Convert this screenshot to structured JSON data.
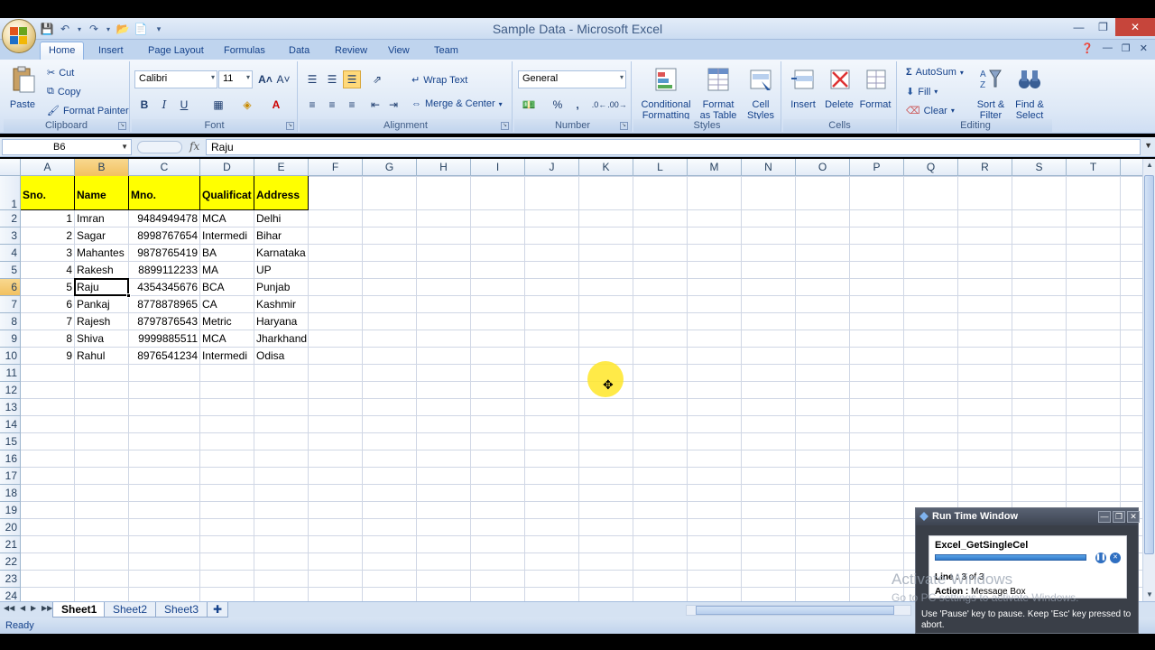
{
  "window": {
    "title": "Sample Data - Microsoft Excel"
  },
  "tabs": [
    "Home",
    "Insert",
    "Page Layout",
    "Formulas",
    "Data",
    "Review",
    "View",
    "Team"
  ],
  "ribbon": {
    "clipboard": {
      "label": "Clipboard",
      "paste": "Paste",
      "cut": "Cut",
      "copy": "Copy",
      "format_painter": "Format Painter"
    },
    "font": {
      "label": "Font",
      "name": "Calibri",
      "size": "11",
      "bold": "B",
      "italic": "I",
      "underline": "U"
    },
    "alignment": {
      "label": "Alignment",
      "wrap_text": "Wrap Text",
      "merge_center": "Merge & Center"
    },
    "number": {
      "label": "Number",
      "format": "General",
      "percent": "%",
      "comma": ","
    },
    "styles": {
      "label": "Styles",
      "conditional": "Conditional",
      "conditional2": "Formatting",
      "format_table": "Format",
      "format_table2": "as Table",
      "cell_styles": "Cell",
      "cell_styles2": "Styles"
    },
    "cells": {
      "label": "Cells",
      "insert": "Insert",
      "delete": "Delete",
      "format": "Format"
    },
    "editing": {
      "label": "Editing",
      "autosum": "AutoSum",
      "fill": "Fill",
      "clear": "Clear",
      "sort": "Sort &",
      "sort2": "Filter",
      "find": "Find &",
      "find2": "Select"
    }
  },
  "formula_bar": {
    "name_box": "B6",
    "fx": "fx",
    "value": "Raju"
  },
  "grid": {
    "columns": [
      "A",
      "B",
      "C",
      "D",
      "E",
      "F",
      "G",
      "H",
      "I",
      "J",
      "K",
      "L",
      "M",
      "N",
      "O",
      "P",
      "Q",
      "R",
      "S",
      "T"
    ],
    "rows": [
      "1",
      "2",
      "3",
      "4",
      "5",
      "6",
      "7",
      "8",
      "9",
      "10",
      "11",
      "12",
      "13",
      "14",
      "15",
      "16",
      "17",
      "18",
      "19",
      "20",
      "21",
      "22",
      "23",
      "24"
    ],
    "headers": [
      "Sno.",
      "Name",
      "Mno.",
      "Qualificat",
      "Address"
    ],
    "data": [
      [
        "1",
        "Imran",
        "9484949478",
        "MCA",
        "Delhi"
      ],
      [
        "2",
        "Sagar",
        "8998767654",
        "Intermedi",
        "Bihar"
      ],
      [
        "3",
        "Mahantes",
        "9878765419",
        "BA",
        "Karnataka"
      ],
      [
        "4",
        "Rakesh",
        "8899112233",
        "MA",
        "UP"
      ],
      [
        "5",
        "Raju",
        "4354345676",
        "BCA",
        "Punjab"
      ],
      [
        "6",
        "Pankaj",
        "8778878965",
        "CA",
        "Kashmir"
      ],
      [
        "7",
        "Rajesh",
        "8797876543",
        "Metric",
        "Haryana"
      ],
      [
        "8",
        "Shiva",
        "9999885511",
        "MCA",
        "Jharkhand"
      ],
      [
        "9",
        "Rahul",
        "8976541234",
        "Intermedi",
        "Odisa"
      ]
    ]
  },
  "sheets": [
    "Sheet1",
    "Sheet2",
    "Sheet3"
  ],
  "status": "Ready",
  "run_time_window": {
    "title": "Run Time Window",
    "task": "Excel_GetSingleCel",
    "line_label": "Line :",
    "line_value": "3 of 3",
    "action_label": "Action :",
    "action_value": "Message Box",
    "hint": "Use 'Pause' key to pause. Keep 'Esc' key pressed to abort."
  },
  "watermark": {
    "line1": "Activate Windows",
    "line2": "Go to PC settings to activate Windows."
  },
  "colors": {
    "header_fill": "#ffff00",
    "selected_header": "#f2c160",
    "ribbon": "#dde8f6"
  }
}
